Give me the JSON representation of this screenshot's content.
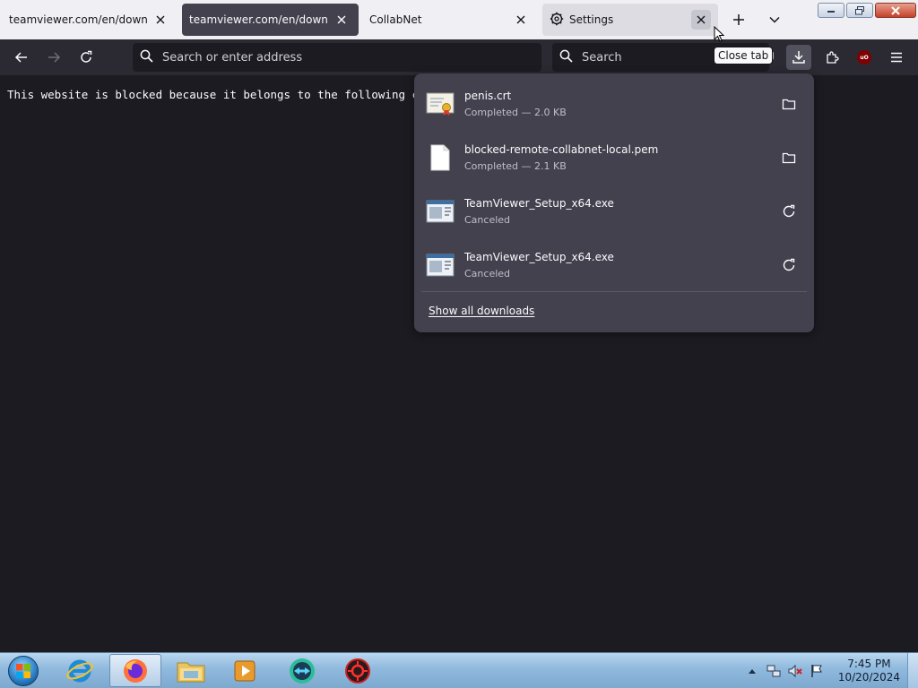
{
  "browser": {
    "tabs": [
      {
        "title": "teamviewer.com/en/download"
      },
      {
        "title": "teamviewer.com/en/download"
      },
      {
        "title": "CollabNet"
      },
      {
        "title": "Settings"
      }
    ],
    "url_placeholder": "Search or enter address",
    "search_placeholder": "Search",
    "tooltip": "Close tab",
    "ublock_label": "uO"
  },
  "content": {
    "message": "This website is blocked because it belongs to the following categ"
  },
  "downloads": {
    "items": [
      {
        "name": "penis.crt",
        "status": "Completed — 2.0 KB",
        "icon": "certificate-file-icon",
        "action": "folder-icon"
      },
      {
        "name": "blocked-remote-collabnet-local.pem",
        "status": "Completed — 2.1 KB",
        "icon": "file-icon",
        "action": "folder-icon"
      },
      {
        "name": "TeamViewer_Setup_x64.exe",
        "status": "Canceled",
        "icon": "exe-file-icon",
        "action": "retry-icon"
      },
      {
        "name": "TeamViewer_Setup_x64.exe",
        "status": "Canceled",
        "icon": "exe-file-icon",
        "action": "retry-icon"
      }
    ],
    "show_all": "Show all downloads"
  },
  "taskbar": {
    "apps": [
      "internet-explorer-icon",
      "firefox-icon",
      "file-explorer-icon",
      "media-player-icon",
      "teamviewer-icon",
      "app-icon"
    ],
    "active_app": "firefox-icon",
    "time": "7:45 PM",
    "date": "10/20/2024"
  }
}
